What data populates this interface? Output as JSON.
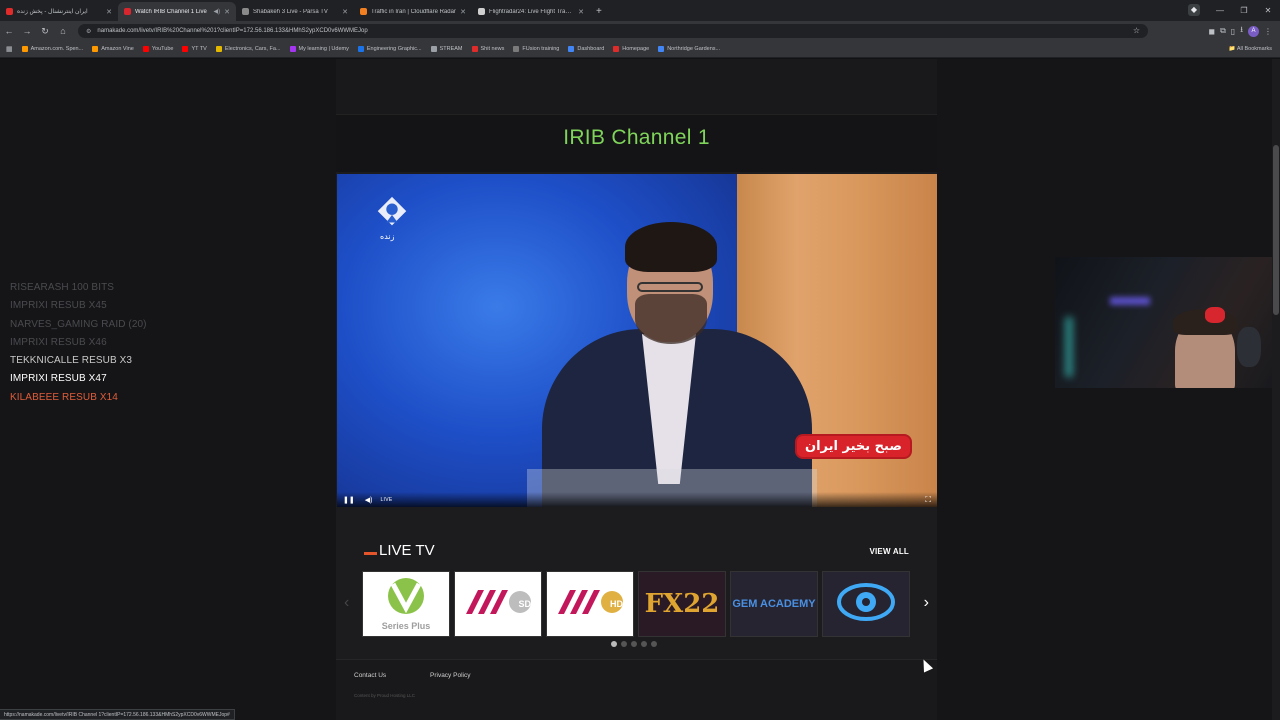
{
  "browser": {
    "tabs": [
      {
        "title": "ایران اینترنشنال - پخش زنده",
        "color": "#e02b2b",
        "active": false
      },
      {
        "title": "Watch IRIB Channel 1 Live",
        "color": "#d8262f",
        "active": true
      },
      {
        "title": "Shabakeh 3 Live - Parsa TV",
        "color": "#8a8a8a",
        "active": false
      },
      {
        "title": "Traffic in Iran | Cloudflare Radar",
        "color": "#f38020",
        "active": false
      },
      {
        "title": "Flightradar24: Live Flight Tracker",
        "color": "#cfcfcf",
        "active": false
      }
    ],
    "url": "namakade.com/livetv/IRIB%20Channel%201?clientIP=172.56.186.133&HMhS2ypXCD0v6WWMEJop",
    "bookmarks": [
      {
        "label": "Amazon.com. Spen...",
        "color": "#ff9900"
      },
      {
        "label": "Amazon Vine",
        "color": "#ff9900"
      },
      {
        "label": "YouTube",
        "color": "#ff0000"
      },
      {
        "label": "YT TV",
        "color": "#ff0000"
      },
      {
        "label": "Electronics, Cars, Fa...",
        "color": "#e5b800"
      },
      {
        "label": "My learning | Udemy",
        "color": "#a435f0"
      },
      {
        "label": "Engineering Graphic...",
        "color": "#1a73e8"
      },
      {
        "label": "STREAM",
        "color": "#9aa0a6"
      },
      {
        "label": "Shit news",
        "color": "#e02b2b"
      },
      {
        "label": "FUsion training",
        "color": "#7a7a7a"
      },
      {
        "label": "Dashboard",
        "color": "#4285f4"
      },
      {
        "label": "Homepage",
        "color": "#e02b2b"
      },
      {
        "label": "Northridge Gardens...",
        "color": "#4285f4"
      }
    ],
    "all_bookmarks": "All Bookmarks",
    "status_url": "https://namakade.com/livetv/IRIB Channel 1?clientIP=172.56.186.133&HMhS2ypXCD0v6WWMEJop#"
  },
  "overlay": {
    "events": [
      {
        "text": "RISEARASH  100 BITS",
        "style": "faded"
      },
      {
        "text": "IMPRIXI  RESUB X45",
        "style": "faded"
      },
      {
        "text": "NARVES_GAMING  RAID (20)",
        "style": "faded"
      },
      {
        "text": "IMPRIXI  RESUB X46",
        "style": "faded"
      },
      {
        "text": "TEKKNICALLE  RESUB X3",
        "style": "mid"
      },
      {
        "text": "IMPRIXI  RESUB X47",
        "style": "bright"
      },
      {
        "text": "KILABEEE  RESUB X14",
        "style": "red"
      }
    ]
  },
  "site": {
    "channel_title": "IRIB Channel 1",
    "player": {
      "logo_caption": "زنده",
      "program_badge": "صبح بخیر ایران",
      "live_label": "LIVE"
    },
    "live_tv": {
      "heading": "LIVE TV",
      "view_all": "VIEW ALL",
      "channels": [
        {
          "name": "Series Plus",
          "style": "white"
        },
        {
          "name": "SD",
          "style": "white"
        },
        {
          "name": "HD",
          "style": "white"
        },
        {
          "name": "FX22",
          "style": "dark"
        },
        {
          "name": "GEM ACADEMY",
          "style": "dark2"
        },
        {
          "name": "Eye",
          "style": "dark2"
        }
      ],
      "active_page": 1,
      "page_count": 5
    },
    "footer": {
      "contact": "Contact Us",
      "privacy": "Privacy Policy",
      "copyright": "Content by Proud Hosting LLC"
    }
  }
}
